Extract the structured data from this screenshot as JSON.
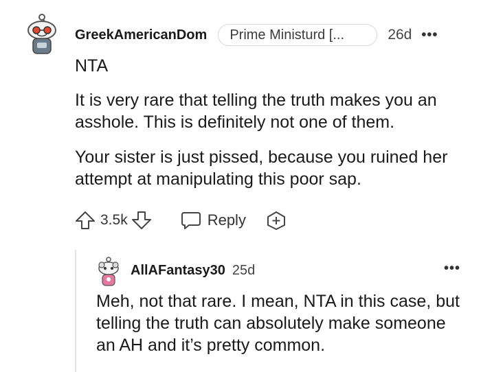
{
  "comment": {
    "username": "GreekAmericanDom",
    "flair": "Prime Ministurd [...",
    "age": "26d",
    "more_label": "•••",
    "paragraphs": [
      "NTA",
      "It is very rare that telling the truth makes you an asshole. This is definitely not one of them.",
      "Your sister is just pissed, because you ruined her attempt at manipulating this poor sap."
    ],
    "score": "3.5k",
    "reply_label": "Reply",
    "avatar_icon": "snoo-avatar-icon",
    "colors": {
      "avatar_accent": "#e8472d",
      "text": "#1a1a1b",
      "muted": "#444444"
    }
  },
  "reply": {
    "username": "AllAFantasy30",
    "age": "25d",
    "more_label": "•••",
    "text": "Meh, not that rare. I mean, NTA in this case, but telling the truth can absolutely make someone an AH and it’s pretty common.",
    "avatar_icon": "snoo-avatar-icon",
    "colors": {
      "avatar_accent": "#e57aa0"
    }
  }
}
